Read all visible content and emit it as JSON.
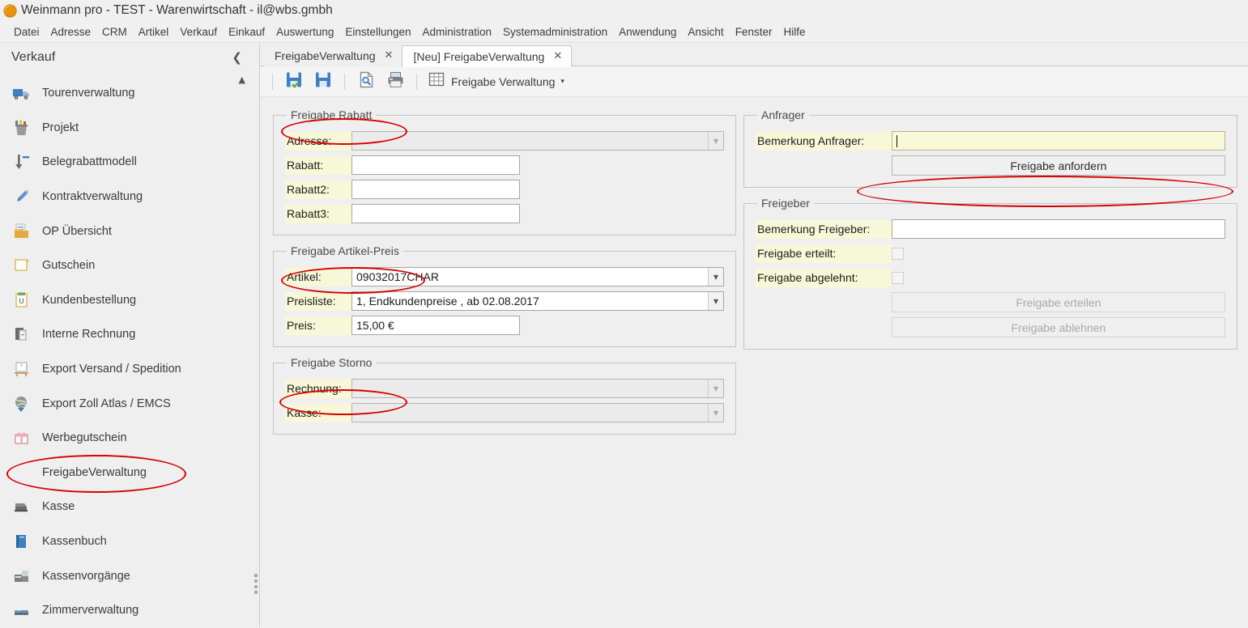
{
  "window": {
    "title": "Weinmann pro - TEST - Warenwirtschaft - il@wbs.gmbh",
    "logo_icon": "orange-crescent-logo"
  },
  "menubar": {
    "items": [
      "Datei",
      "Adresse",
      "CRM",
      "Artikel",
      "Verkauf",
      "Einkauf",
      "Auswertung",
      "Einstellungen",
      "Administration",
      "Systemadministration",
      "Anwendung",
      "Ansicht",
      "Fenster",
      "Hilfe"
    ]
  },
  "sidebar": {
    "title": "Verkauf",
    "collapse_icon": "chevron-left-icon",
    "scrollup_icon": "triangle-up-icon",
    "items": [
      {
        "label": "Tourenverwaltung",
        "icon": "truck-icon",
        "selected": false
      },
      {
        "label": "Projekt",
        "icon": "project-bin-icon",
        "selected": false
      },
      {
        "label": "Belegrabattmodell",
        "icon": "arrow-down-icon",
        "selected": false
      },
      {
        "label": "Kontraktverwaltung",
        "icon": "pen-icon",
        "selected": false
      },
      {
        "label": "OP Übersicht",
        "icon": "folder-doc-icon",
        "selected": false
      },
      {
        "label": "Gutschein",
        "icon": "voucher-icon",
        "selected": false
      },
      {
        "label": "Kundenbestellung",
        "icon": "clipboard-icon",
        "selected": false
      },
      {
        "label": "Interne Rechnung",
        "icon": "book-doc-icon",
        "selected": false
      },
      {
        "label": "Export Versand / Spedition",
        "icon": "pallet-box-icon",
        "selected": false
      },
      {
        "label": "Export Zoll Atlas / EMCS",
        "icon": "globe-arrow-icon",
        "selected": false
      },
      {
        "label": "Werbegutschein",
        "icon": "gift-icon",
        "selected": false
      },
      {
        "label": "FreigabeVerwaltung",
        "icon": "none",
        "selected": true
      },
      {
        "label": "Kasse",
        "icon": "register-icon",
        "selected": false
      },
      {
        "label": "Kassenbuch",
        "icon": "blue-book-icon",
        "selected": false
      },
      {
        "label": "Kassenvorgänge",
        "icon": "pos-terminal-icon",
        "selected": false
      },
      {
        "label": "Zimmerverwaltung",
        "icon": "bed-icon",
        "selected": false
      }
    ]
  },
  "tabs": [
    {
      "label": "FreigabeVerwaltung",
      "active": false,
      "close_icon": "close-icon"
    },
    {
      "label": "[Neu] FreigabeVerwaltung",
      "active": true,
      "close_icon": "close-icon"
    }
  ],
  "toolbar": {
    "buttons": [
      {
        "icon": "save-check-icon",
        "tip": "Speichern und schliessen"
      },
      {
        "icon": "save-icon",
        "tip": "Speichern"
      },
      {
        "icon": "print-preview-icon",
        "tip": "Druckvorschau"
      },
      {
        "icon": "printer-icon",
        "tip": "Drucken"
      }
    ],
    "grid": {
      "icon": "table-grid-icon",
      "label": "Freigabe Verwaltung",
      "caret": "▾"
    }
  },
  "form": {
    "groups": {
      "rabatt": {
        "legend": "Freigabe Rabatt",
        "fields": [
          {
            "label": "Adresse:",
            "value": "",
            "type": "combo",
            "disabled": true,
            "width": "wide"
          },
          {
            "label": "Rabatt:",
            "value": "",
            "type": "text",
            "disabled": false,
            "width": "short"
          },
          {
            "label": "Rabatt2:",
            "value": "",
            "type": "text",
            "disabled": false,
            "width": "short"
          },
          {
            "label": "Rabatt3:",
            "value": "",
            "type": "text",
            "disabled": false,
            "width": "short"
          }
        ]
      },
      "artikel_preis": {
        "legend": "Freigabe Artikel-Preis",
        "fields": [
          {
            "label": "Artikel:",
            "value": "09032017CHAR",
            "type": "combo",
            "disabled": false,
            "width": "wide"
          },
          {
            "label": "Preisliste:",
            "value": "1, Endkundenpreise , ab 02.08.2017",
            "type": "combo",
            "disabled": false,
            "width": "wide"
          },
          {
            "label": "Preis:",
            "value": "15,00 €",
            "type": "text",
            "disabled": false,
            "width": "short"
          }
        ]
      },
      "storno": {
        "legend": "Freigabe Storno",
        "fields": [
          {
            "label": "Rechnung:",
            "value": "",
            "type": "combo",
            "disabled": true,
            "width": "wide"
          },
          {
            "label": "Kasse:",
            "value": "",
            "type": "combo",
            "disabled": true,
            "width": "wide"
          }
        ]
      },
      "anfrager": {
        "legend": "Anfrager",
        "comment_label": "Bemerkung Anfrager:",
        "comment_value": "",
        "comment_focused": true,
        "request_button": "Freigabe anfordern"
      },
      "freigeber": {
        "legend": "Freigeber",
        "comment_label": "Bemerkung Freigeber:",
        "comment_value": "",
        "granted_label": "Freigabe erteilt:",
        "granted_checked": false,
        "rejected_label": "Freigabe abgelehnt:",
        "rejected_checked": false,
        "grant_button": "Freigabe erteilen",
        "grant_button_disabled": true,
        "reject_button": "Freigabe ablehnen",
        "reject_button_disabled": true
      }
    }
  },
  "annotations": {
    "color": "#d40000",
    "shapes": [
      {
        "target": "sidebar-item-freigabeverwaltung"
      },
      {
        "target": "legend-freigabe-rabatt"
      },
      {
        "target": "legend-freigabe-artikel-preis"
      },
      {
        "target": "legend-freigabe-storno"
      },
      {
        "target": "freigabe-anfordern-button"
      }
    ]
  }
}
